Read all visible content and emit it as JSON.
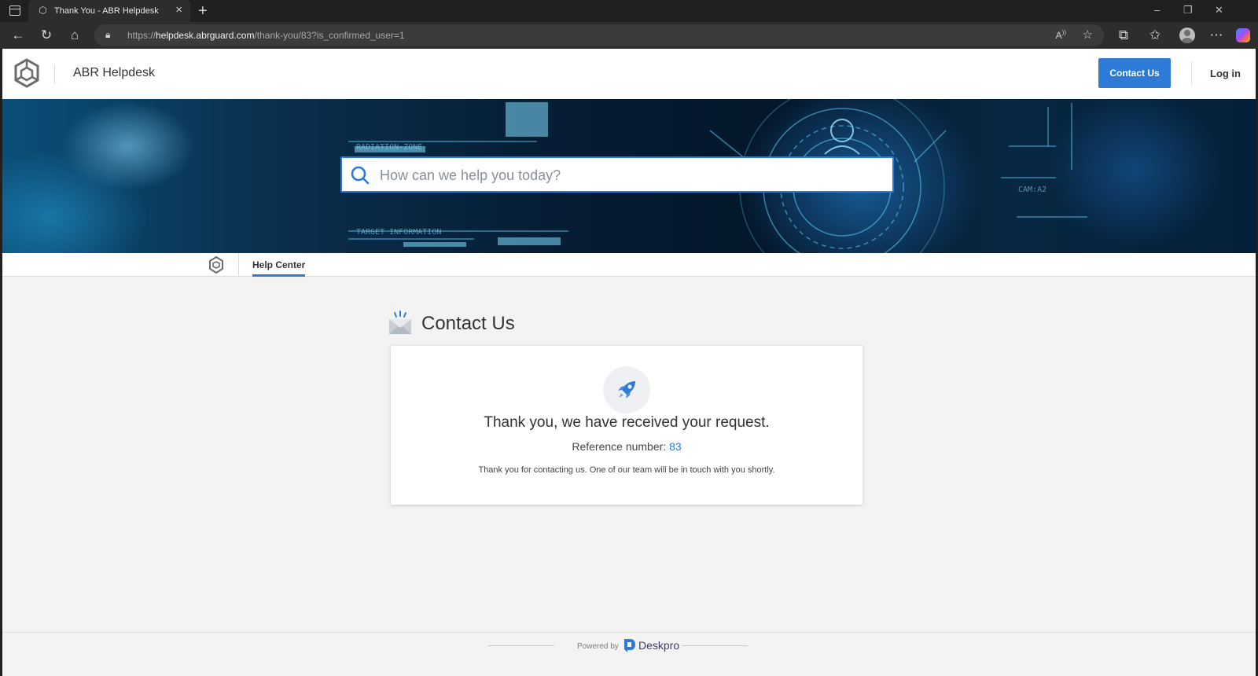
{
  "browser": {
    "tab_title": "Thank You - ABR Helpdesk",
    "tab_favicon": "helpdesk-favicon",
    "tab_close": "×",
    "new_tab": "+",
    "url_host_prefix": "https://",
    "url_host": "helpdesk.abrguard.com",
    "url_path": "/thank-you/83?is_confirmed_user=1",
    "win_min": "–",
    "win_restore": "❐",
    "win_close": "✕"
  },
  "header": {
    "site_name": "ABR Helpdesk",
    "contact_button": "Contact Us",
    "login_link": "Log in"
  },
  "search": {
    "placeholder": "How can we help you today?"
  },
  "subnav": {
    "items": [
      {
        "label": "Help Center",
        "active": true
      }
    ]
  },
  "main": {
    "heading": "Contact Us",
    "confirmation": {
      "title": "Thank you, we have received your request.",
      "reference_label": "Reference number:",
      "reference_number": "83",
      "message": "Thank you for contacting us. One of our team will be in touch with you shortly."
    }
  },
  "footer": {
    "powered_by": "Powered by",
    "brand": "Deskpro"
  },
  "colors": {
    "accent": "#2d7bd6",
    "page_bg": "#f3f3f3",
    "chrome_bg": "#202020"
  }
}
